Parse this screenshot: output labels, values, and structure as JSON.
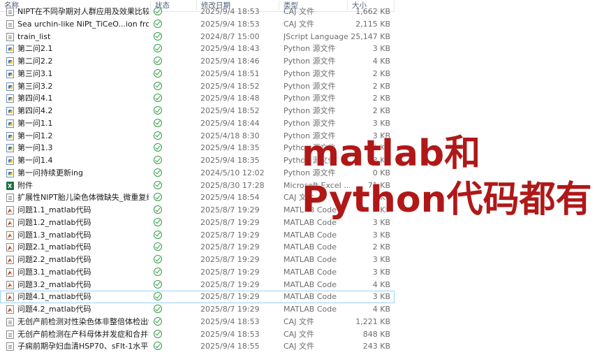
{
  "header": {
    "name": "名称",
    "status": "状态",
    "date": "修改日期",
    "type": "类型",
    "size": "大小"
  },
  "files": [
    {
      "name": "NIPT在不同孕期对人群应用及效果比较研究",
      "date": "2025/9/4 18:53",
      "type": "CAJ 文件",
      "size": "1,662 KB",
      "icon": "document-icon"
    },
    {
      "name": "Sea urchin-like NiPt_TiCeO...ion from ...",
      "date": "2025/9/4 18:53",
      "type": "CAJ 文件",
      "size": "2,115 KB",
      "icon": "document-icon"
    },
    {
      "name": "train_list",
      "date": "2024/8/7 15:00",
      "type": "JScript Language",
      "size": "25,147 KB",
      "icon": "document-icon"
    },
    {
      "name": "第二问2.1",
      "date": "2025/9/4 18:43",
      "type": "Python 源文件",
      "size": "3 KB",
      "icon": "python-file-icon"
    },
    {
      "name": "第二问2.2",
      "date": "2025/9/4 18:46",
      "type": "Python 源文件",
      "size": "4 KB",
      "icon": "python-file-icon"
    },
    {
      "name": "第三问3.1",
      "date": "2025/9/4 18:51",
      "type": "Python 源文件",
      "size": "2 KB",
      "icon": "python-file-icon"
    },
    {
      "name": "第三问3.2",
      "date": "2025/9/4 18:52",
      "type": "Python 源文件",
      "size": "2 KB",
      "icon": "python-file-icon"
    },
    {
      "name": "第四问4.1",
      "date": "2025/9/4 18:48",
      "type": "Python 源文件",
      "size": "2 KB",
      "icon": "python-file-icon"
    },
    {
      "name": "第四问4.2",
      "date": "2025/9/4 18:52",
      "type": "Python 源文件",
      "size": "2 KB",
      "icon": "python-file-icon"
    },
    {
      "name": "第一问1.1",
      "date": "2025/9/4 18:44",
      "type": "Python 源文件",
      "size": "3 KB",
      "icon": "python-file-icon"
    },
    {
      "name": "第一问1.2",
      "date": "2025/4/18 8:30",
      "type": "Python 源文件",
      "size": "3 KB",
      "icon": "python-file-icon"
    },
    {
      "name": "第一问1.3",
      "date": "2025/9/4 18:35",
      "type": "Python 源文件",
      "size": "3 KB",
      "icon": "python-file-icon"
    },
    {
      "name": "第一问1.4",
      "date": "2025/9/4 18:35",
      "type": "Python 源文件",
      "size": "3 KB",
      "icon": "python-file-icon"
    },
    {
      "name": "第一问持续更新ing",
      "date": "2024/5/10 12:02",
      "type": "Python 源文件",
      "size": "0 KB",
      "icon": "python-file-icon"
    },
    {
      "name": "附件",
      "date": "2025/8/30 17:28",
      "type": "Microsoft Excel ...",
      "size": "71 KB",
      "icon": "excel-icon"
    },
    {
      "name": "扩展性NIPT胎儿染色体微缺失_微重复综...",
      "date": "2025/9/4 18:54",
      "type": "CAJ 文件",
      "size": "2 KB",
      "icon": "document-icon"
    },
    {
      "name": "问题1.1_matlab代码",
      "date": "2025/8/7 19:29",
      "type": "MATLAB Code",
      "size": "3 KB",
      "icon": "matlab-file-icon"
    },
    {
      "name": "问题1.2_matlab代码",
      "date": "2025/8/7 19:29",
      "type": "MATLAB Code",
      "size": "3 KB",
      "icon": "matlab-file-icon"
    },
    {
      "name": "问题1.3_matlab代码",
      "date": "2025/8/7 19:29",
      "type": "MATLAB Code",
      "size": "3 KB",
      "icon": "matlab-file-icon"
    },
    {
      "name": "问题2.1_matlab代码",
      "date": "2025/8/7 19:29",
      "type": "MATLAB Code",
      "size": "2 KB",
      "icon": "matlab-file-icon"
    },
    {
      "name": "问题2.2_matlab代码",
      "date": "2025/8/7 19:29",
      "type": "MATLAB Code",
      "size": "3 KB",
      "icon": "matlab-file-icon"
    },
    {
      "name": "问题3.1_matlab代码",
      "date": "2025/8/7 19:29",
      "type": "MATLAB Code",
      "size": "3 KB",
      "icon": "matlab-file-icon"
    },
    {
      "name": "问题3.2_matlab代码",
      "date": "2025/8/7 19:29",
      "type": "MATLAB Code",
      "size": "4 KB",
      "icon": "matlab-file-icon"
    },
    {
      "name": "问题4.1_matlab代码",
      "date": "2025/8/7 19:29",
      "type": "MATLAB Code",
      "size": "3 KB",
      "icon": "matlab-file-icon",
      "selected": true
    },
    {
      "name": "问题4.2_matlab代码",
      "date": "2025/8/7 19:29",
      "type": "MATLAB Code",
      "size": "4 KB",
      "icon": "matlab-file-icon"
    },
    {
      "name": "无创产前检测对性染色体非整倍体检出情...",
      "date": "2025/9/4 18:53",
      "type": "CAJ 文件",
      "size": "1,221 KB",
      "icon": "document-icon"
    },
    {
      "name": "无创产前检测在产科母体并发症和合并症...",
      "date": "2025/9/4 18:53",
      "type": "CAJ 文件",
      "size": "848 KB",
      "icon": "document-icon"
    },
    {
      "name": "子痫前期孕妇血清HSP70、sFlt-1水平及...",
      "date": "2025/9/4 18:55",
      "type": "CAJ 文件",
      "size": "243 KB",
      "icon": "document-icon"
    }
  ],
  "overlay": {
    "line1": "matlab和",
    "line2": "Python代码都有",
    "color": "#b01818"
  }
}
